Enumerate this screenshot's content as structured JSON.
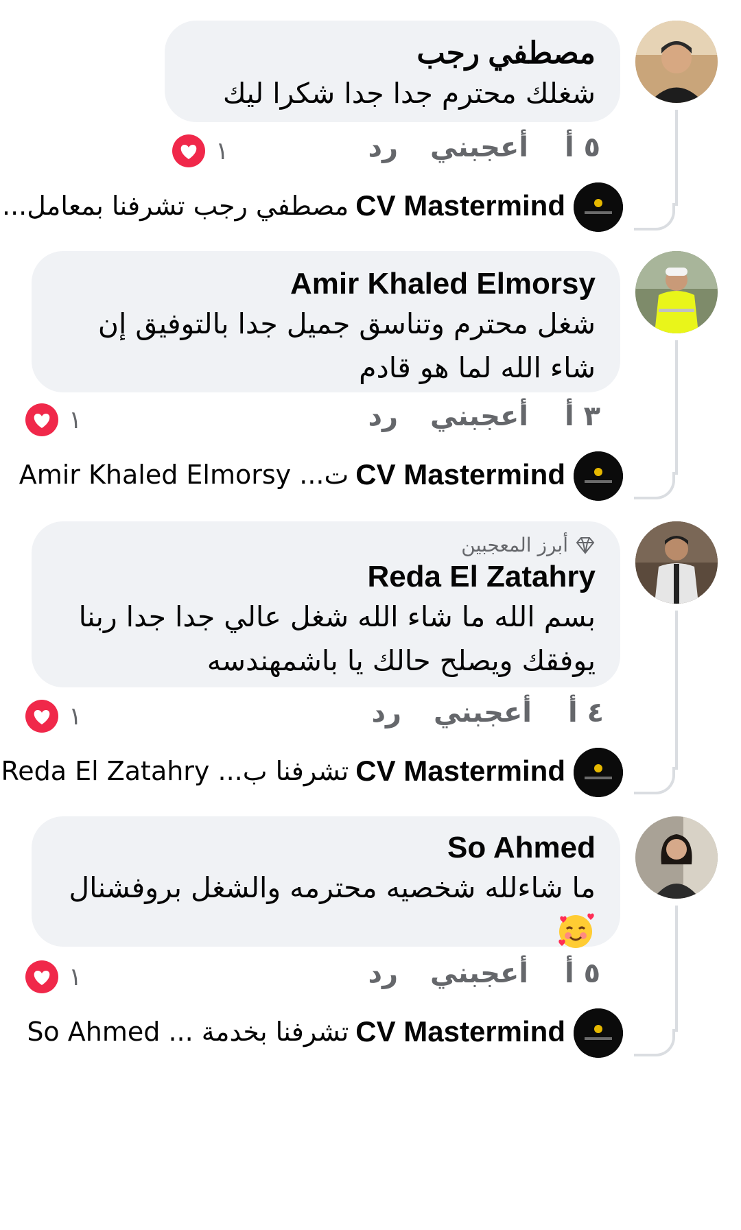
{
  "comments": [
    {
      "author": "مصطفي رجب",
      "text": "شغلك محترم جدا جدا شكرا ليك",
      "time": "٥ أ",
      "like_label": "أعجبني",
      "reply_label": "رد",
      "reaction_count": "١",
      "reply": {
        "author": "CV Mastermind",
        "text": "مصطفي رجب تشرفنا بمعامل..."
      }
    },
    {
      "author": "Amir Khaled Elmorsy",
      "text": "شغل محترم وتناسق جميل جدا بالتوفيق إن شاء الله لما هو قادم",
      "time": "٣ أ",
      "like_label": "أعجبني",
      "reply_label": "رد",
      "reaction_count": "١",
      "reply": {
        "author": "CV Mastermind",
        "text": "ت... Amir Khaled Elmorsy"
      }
    },
    {
      "badge": "أبرز المعجبين",
      "author": "Reda El Zatahry",
      "text": "بسم الله ما شاء الله شغل عالي جدا جدا ربنا يوفقك ويصلح حالك يا باشمهندسه",
      "time": "٤ أ",
      "like_label": "أعجبني",
      "reply_label": "رد",
      "reaction_count": "١",
      "reply": {
        "author": "CV Mastermind",
        "text": "تشرفنا ب... Reda El Zatahry"
      }
    },
    {
      "author": "So Ahmed",
      "text": "ما شاءلله شخصيه محترمه والشغل بروفشنال",
      "time": "٥ أ",
      "like_label": "أعجبني",
      "reply_label": "رد",
      "reaction_count": "١",
      "reply": {
        "author": "CV Mastermind",
        "text": "تشرفنا بخدمة ... So Ahmed"
      }
    }
  ],
  "colors": {
    "bubble": "#f0f2f5",
    "secondary_text": "#65676b",
    "heart": "#f0284a",
    "thread_line": "#dadde1"
  },
  "icons": {
    "reaction": "heart-icon",
    "badge": "diamond-icon",
    "emoji": "smiling-face-with-hearts"
  }
}
